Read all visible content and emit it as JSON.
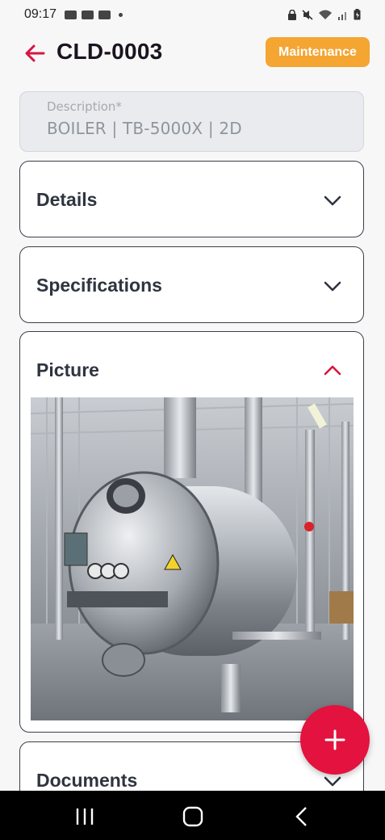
{
  "status_bar": {
    "time": "09:17"
  },
  "header": {
    "title": "CLD-0003",
    "status_badge": "Maintenance"
  },
  "description": {
    "label": "Description*",
    "value": "BOILER | TB-5000X | 2D"
  },
  "sections": {
    "details": {
      "title": "Details",
      "expanded": false
    },
    "specifications": {
      "title": "Specifications",
      "expanded": false
    },
    "picture": {
      "title": "Picture",
      "expanded": true
    },
    "documents": {
      "title": "Documents",
      "expanded": false
    }
  },
  "colors": {
    "accent": "#e3123f",
    "badge": "#f4a532",
    "title": "#1b1420"
  },
  "icons": {
    "back": "arrow-left-icon",
    "expand": "chevron-down-icon",
    "collapse": "chevron-up-icon",
    "fab": "plus-icon"
  }
}
